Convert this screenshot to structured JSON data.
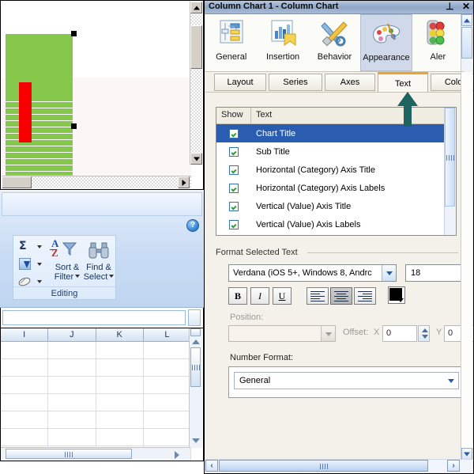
{
  "panel": {
    "title": "Column Chart 1 - Column Chart",
    "pin_icon": "pin-icon",
    "close_icon": "close-icon",
    "pin_glyph": "⊥",
    "close_glyph": "✕",
    "ribbon": [
      {
        "label": "General",
        "icon": "sliders-icon",
        "active": false
      },
      {
        "label": "Insertion",
        "icon": "bar-chart-insert-icon",
        "active": false
      },
      {
        "label": "Behavior",
        "icon": "wrench-screwdriver-icon",
        "active": false
      },
      {
        "label": "Appearance",
        "icon": "paint-palette-icon",
        "active": true
      },
      {
        "label": "Aler",
        "icon": "traffic-light-icon",
        "active": false
      }
    ],
    "tabs": [
      {
        "label": "Layout",
        "selected": false
      },
      {
        "label": "Series",
        "selected": false
      },
      {
        "label": "Axes",
        "selected": false
      },
      {
        "label": "Text",
        "selected": true
      },
      {
        "label": "Color",
        "selected": false
      }
    ],
    "selected_tab_accent": "#f0a22e",
    "annotation_arrow_color": "#1f6360"
  },
  "text_tab": {
    "list": {
      "columns": [
        "Show",
        "Text"
      ],
      "rows": [
        {
          "show": true,
          "text": "Chart Title",
          "selected": true
        },
        {
          "show": true,
          "text": "Sub Title",
          "selected": false
        },
        {
          "show": true,
          "text": "Horizontal (Category) Axis Title",
          "selected": false
        },
        {
          "show": true,
          "text": "Horizontal (Category) Axis Labels",
          "selected": false
        },
        {
          "show": true,
          "text": "Vertical (Value) Axis Title",
          "selected": false
        },
        {
          "show": true,
          "text": "Vertical (Value) Axis Labels",
          "selected": false
        }
      ],
      "selection_color": "#2a5db0"
    },
    "format_group_label": "Format Selected Text",
    "font_family_value": "Verdana (iOS 5+, Windows 8, Andrc",
    "font_size_value": "18",
    "bold_label": "B",
    "italic_label": "I",
    "underline_label": "U",
    "align_left": "align-left",
    "align_center": "align-center",
    "align_right": "align-right",
    "align_active": "align-center",
    "text_color": "#000000",
    "position_label": "Position:",
    "position_value": "",
    "offset_label": "Offset:",
    "offset_x_label": "X",
    "offset_x_value": "0",
    "offset_y_label": "Y",
    "offset_y_value": "0",
    "number_format_label": "Number Format:",
    "number_format_value": "General"
  },
  "excel": {
    "chart": {
      "plot_color": "#85c74b",
      "bar_color": "#f80000",
      "gridline_color": "#ffffff",
      "baseline_color": "#bfbfbf"
    },
    "ribbon_group": {
      "title": "Editing",
      "autosum_label": "Σ",
      "autosum_name": "autosum-button",
      "fill_name": "fill-button",
      "clear_name": "clear-button",
      "sort_filter_label_1": "Sort &",
      "sort_filter_label_2": "Filter",
      "find_select_label_1": "Find &",
      "find_select_label_2": "Select",
      "help_label": "?"
    },
    "grid": {
      "columns": [
        "I",
        "J",
        "K",
        "L"
      ],
      "row_count": 7,
      "name_box_value": ""
    }
  }
}
